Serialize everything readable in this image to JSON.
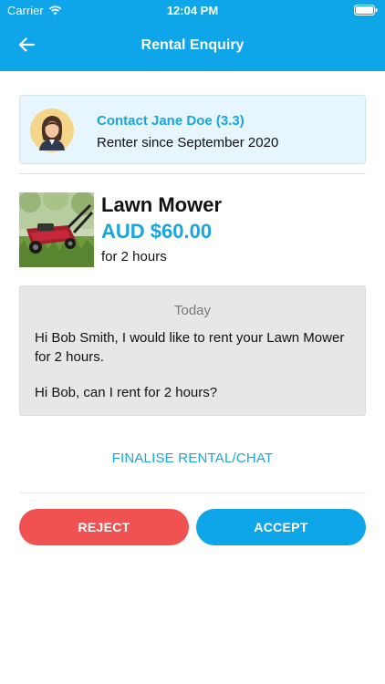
{
  "status_bar": {
    "carrier": "Carrier",
    "time": "12:04 PM"
  },
  "nav": {
    "title": "Rental Enquiry",
    "back_icon": "arrow-left-icon"
  },
  "contact": {
    "name": "Contact Jane Doe (3.3)",
    "renter_since": "Renter since September 2020"
  },
  "item": {
    "name": "Lawn Mower",
    "price": "AUD $60.00",
    "duration": "for 2 hours"
  },
  "message": {
    "date": "Today",
    "text": "Hi Bob Smith, I would like to rent your Lawn Mower  for 2 hours.",
    "text2": "Hi Bob, can I rent for 2 hours?"
  },
  "actions": {
    "finalise": "FINALISE RENTAL/CHAT",
    "reject": "REJECT",
    "accept": "ACCEPT"
  },
  "colors": {
    "primary": "#0ea5e9",
    "accent_text": "#1ba5dc",
    "reject": "#f05252"
  }
}
